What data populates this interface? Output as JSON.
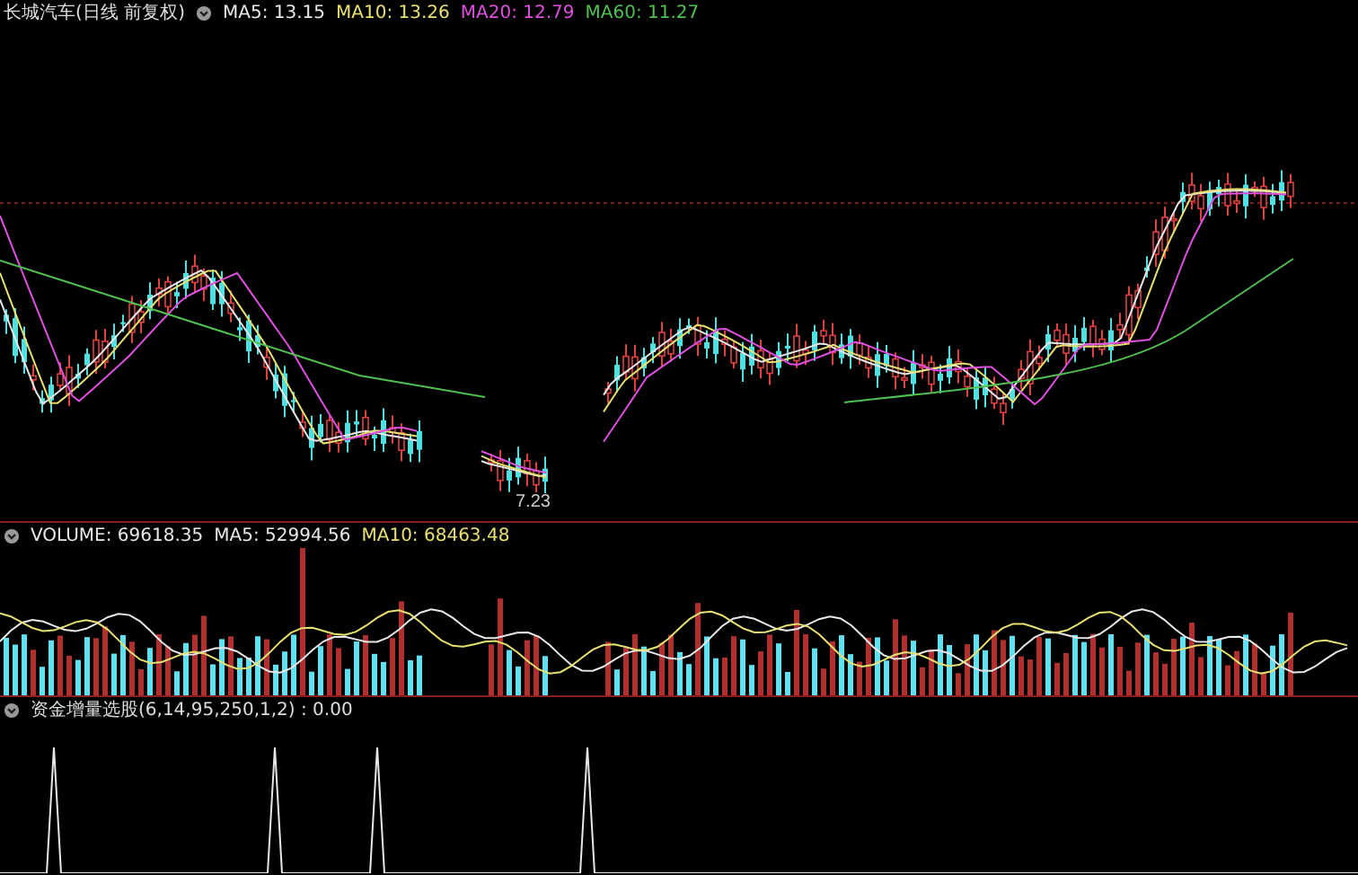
{
  "price_panel": {
    "title": "长城汽车(日线 前复权)",
    "legend": [
      {
        "text": "MA5: 13.15",
        "color": "#e8e8e8"
      },
      {
        "text": "MA10: 13.26",
        "color": "#e8e070"
      },
      {
        "text": "MA20: 12.79",
        "color": "#e050e0"
      },
      {
        "text": "MA60: 11.27",
        "color": "#50c050"
      }
    ],
    "low_label": "7.23"
  },
  "volume_panel": {
    "legend": [
      {
        "text": "VOLUME: 69618.35",
        "color": "#e8e8e8"
      },
      {
        "text": "MA5: 52994.56",
        "color": "#e8e8e8"
      },
      {
        "text": "MA10: 68463.48",
        "color": "#e8e070"
      }
    ]
  },
  "indicator_panel": {
    "legend": "资金增量选股(6,14,95,250,1,2) : 0.00"
  }
}
